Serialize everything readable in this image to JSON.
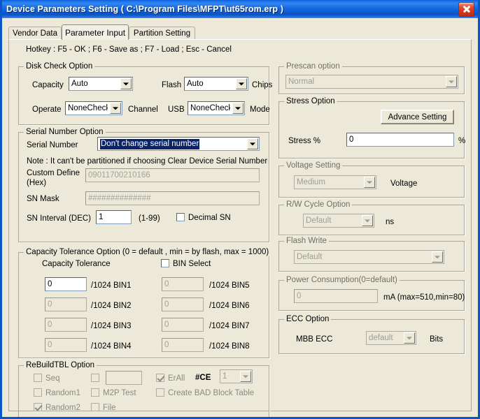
{
  "window": {
    "title": "Device Parameters Setting ( C:\\Program Files\\MFPT\\ut65rom.erp )",
    "close_label": "close-icon"
  },
  "tabs": [
    {
      "label": "Vendor Data",
      "active": false
    },
    {
      "label": "Parameter Input",
      "active": true
    },
    {
      "label": "Partition Setting",
      "active": false
    }
  ],
  "hotkey": "Hotkey : F5 - OK ; F6 - Save as ; F7 - Load ; Esc - Cancel",
  "disk_check": {
    "title": "Disk Check Option",
    "capacity_label": "Capacity",
    "capacity_value": "Auto",
    "flash_label": "Flash",
    "flash_value": "Auto",
    "chips_label": "Chips",
    "operate_label": "Operate",
    "operate_value": "NoneCheck",
    "channel_label": "Channel",
    "usb_label": "USB",
    "usb_value": "NoneCheck",
    "mode_label": "Mode"
  },
  "serial_number": {
    "title": "Serial Number Option",
    "sn_label": "Serial Number",
    "sn_value": "Don't change serial number",
    "note": "Note : It can't be partitioned if choosing Clear Device Serial Number",
    "custom_label_line1": "Custom Define",
    "custom_label_line2": "(Hex)",
    "custom_value": "09011700210166",
    "mask_label": "SN Mask",
    "mask_value": "##############",
    "interval_label": "SN Interval (DEC)",
    "interval_value": "1",
    "interval_range": "(1-99)",
    "decimal_label": "Decimal SN",
    "decimal_checked": false
  },
  "capacity_tolerance": {
    "title": "Capacity Tolerance Option (0 = default , min = by flash, max = 1000)",
    "subtitle": "Capacity Tolerance",
    "bin_select_label": "BIN Select",
    "bin_select_checked": false,
    "bins": [
      {
        "label": "/1024 BIN1",
        "value": "0",
        "enabled": true
      },
      {
        "label": "/1024 BIN2",
        "value": "0",
        "enabled": false
      },
      {
        "label": "/1024 BIN3",
        "value": "0",
        "enabled": false
      },
      {
        "label": "/1024 BIN4",
        "value": "0",
        "enabled": false
      },
      {
        "label": "/1024 BIN5",
        "value": "0",
        "enabled": false
      },
      {
        "label": "/1024 BIN6",
        "value": "0",
        "enabled": false
      },
      {
        "label": "/1024 BIN7",
        "value": "0",
        "enabled": false
      },
      {
        "label": "/1024 BIN8",
        "value": "0",
        "enabled": false
      }
    ]
  },
  "rebuild_tbl": {
    "title": "ReBuildTBL Option",
    "seq_label": "Seq",
    "seq_checked": false,
    "random1_label": "Random1",
    "random1_checked": false,
    "random2_label": "Random2",
    "random2_checked": true,
    "blank_checked": false,
    "blank_text": "",
    "m2p_label": "M2P Test",
    "m2p_checked": false,
    "file_label": "File",
    "file_checked": false,
    "erall_label": "ErAll",
    "erall_checked": true,
    "create_bad_label": "Create BAD Block Table",
    "create_bad_checked": false,
    "ce_label": "#CE",
    "ce_value": "1"
  },
  "prescan": {
    "title": "Prescan option",
    "value": "Normal"
  },
  "stress": {
    "title": "Stress Option",
    "advance_button": "Advance Setting",
    "stress_label": "Stress %",
    "stress_value": "0",
    "percent_label": "%"
  },
  "voltage": {
    "title": "Voltage Setting",
    "value": "Medium",
    "unit_label": "Voltage"
  },
  "rw_cycle": {
    "title": "R/W Cycle Option",
    "value": "Default",
    "unit_label": "ns"
  },
  "flash_write": {
    "title": "Flash Write",
    "value": "Default"
  },
  "power": {
    "title": "Power Consumption(0=default)",
    "value": "0",
    "unit_label": "mA (max=510,min=80)"
  },
  "ecc": {
    "title": "ECC Option",
    "label": "MBB ECC",
    "value": "default",
    "unit_label": "Bits"
  }
}
